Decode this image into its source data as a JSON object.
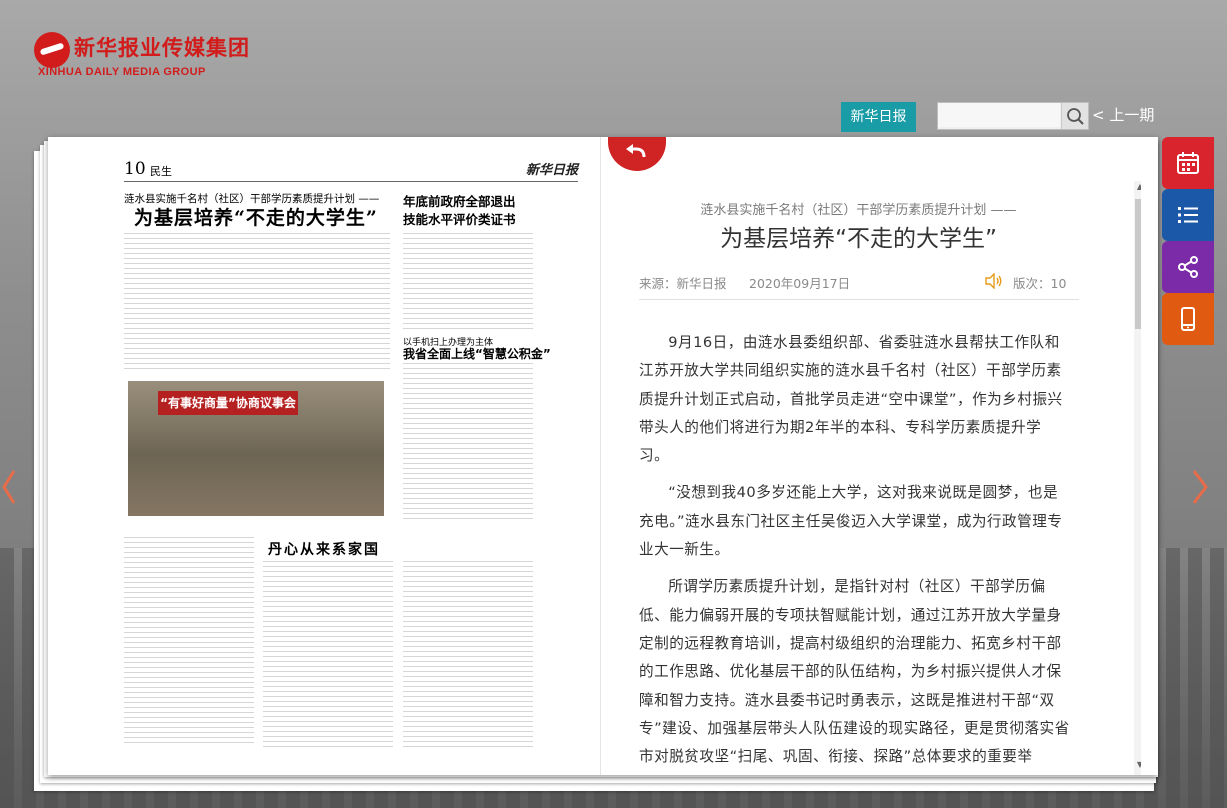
{
  "logo": {
    "zh": "新华报业传媒集团",
    "en": "XINHUA DAILY MEDIA GROUP"
  },
  "header": {
    "paper_button": "新华日报",
    "search_placeholder": "",
    "prev_issue": "< 上一期"
  },
  "newspaper": {
    "page_number": "10",
    "section": "民生",
    "masthead": "新华日报",
    "lead": "涟水县实施千名村（社区）干部学历素质提升计划 ——",
    "headline": "为基层培养“不走的大学生”",
    "side_headline_1": "年底前政府全部退出",
    "side_headline_2": "技能水平评价类证书",
    "side_sub_1": "以手机扫上办理为主体",
    "side_sub_2": "我省全面上线“智慧公积金”",
    "photo_banner": "“有事好商量”协商议事会",
    "headline_2": "丹心从来系家国"
  },
  "article": {
    "subtitle": "涟水县实施千名村（社区）干部学历素质提升计划 ——",
    "title": "为基层培养“不走的大学生”",
    "source": "来源：新华日报",
    "date": "2020年09月17日",
    "edition": "版次：10",
    "paragraphs": [
      "9月16日，由涟水县委组织部、省委驻涟水县帮扶工作队和江苏开放大学共同组织实施的涟水县千名村（社区）干部学历素质提升计划正式启动，首批学员走进“空中课堂”，作为乡村振兴带头人的他们将进行为期2年半的本科、专科学历素质提升学习。",
      "“没想到我40多岁还能上大学，这对我来说既是圆梦，也是充电。”涟水县东门社区主任吴俊迈入大学课堂，成为行政管理专业大一新生。",
      "所谓学历素质提升计划，是指针对村（社区）干部学历偏低、能力偏弱开展的专项扶智赋能计划，通过江苏开放大学量身定制的远程教育培训，提高村级组织的治理能力、拓宽乡村干部的工作思路、优化基层干部的队伍结构，为乡村振兴提供人才保障和智力支持。涟水县委书记时勇表示，这既是推进村干部“双专”建设、加强基层带头人队伍建设的现实路径，更是贯彻落实省市对脱贫攻坚“扫尾、巩固、衔接、探路”总体要求的重要举"
    ]
  },
  "colors": {
    "accent_teal": "#1a9ca6",
    "brand_red": "#d21c1c",
    "tool_calendar": "#d9232d",
    "tool_list": "#1c58a8",
    "tool_share": "#7b2aa8",
    "tool_mobile": "#e05a12"
  },
  "icons": [
    "search-icon",
    "back-icon",
    "speaker-icon",
    "calendar-icon",
    "list-icon",
    "share-icon",
    "mobile-icon",
    "chevron-left-icon",
    "chevron-right-icon"
  ]
}
